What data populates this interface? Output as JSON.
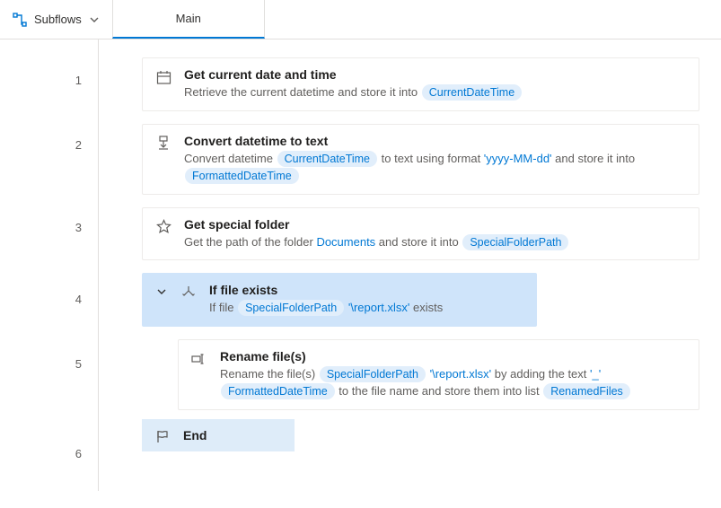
{
  "toolbar": {
    "subflows_label": "Subflows",
    "tab_main": "Main"
  },
  "lines": [
    "1",
    "2",
    "3",
    "4",
    "5",
    "6"
  ],
  "actions": {
    "a1": {
      "title": "Get current date and time",
      "desc_pre": "Retrieve the current datetime and store it into ",
      "var1": "CurrentDateTime"
    },
    "a2": {
      "title": "Convert datetime to text",
      "d1": "Convert datetime ",
      "v1": "CurrentDateTime",
      "d2": " to text using format ",
      "lit1": "'yyyy-MM-dd'",
      "d3": " and store it into ",
      "v2": "FormattedDateTime"
    },
    "a3": {
      "title": "Get special folder",
      "d1": "Get the path of the folder ",
      "link1": "Documents",
      "d2": " and store it into ",
      "v1": "SpecialFolderPath"
    },
    "a4": {
      "title": "If file exists",
      "d1": "If file ",
      "v1": "SpecialFolderPath",
      "lit1": "'\\report.xlsx'",
      "d2": " exists"
    },
    "a5": {
      "title": "Rename file(s)",
      "d1": "Rename the file(s) ",
      "v1": "SpecialFolderPath",
      "lit1": "'\\report.xlsx'",
      "d2": " by adding the text ",
      "lit2": "'_'",
      "v2": "FormattedDateTime",
      "d3": " to the file name and store them into list ",
      "v3": "RenamedFiles"
    },
    "a6": {
      "title": "End"
    }
  }
}
